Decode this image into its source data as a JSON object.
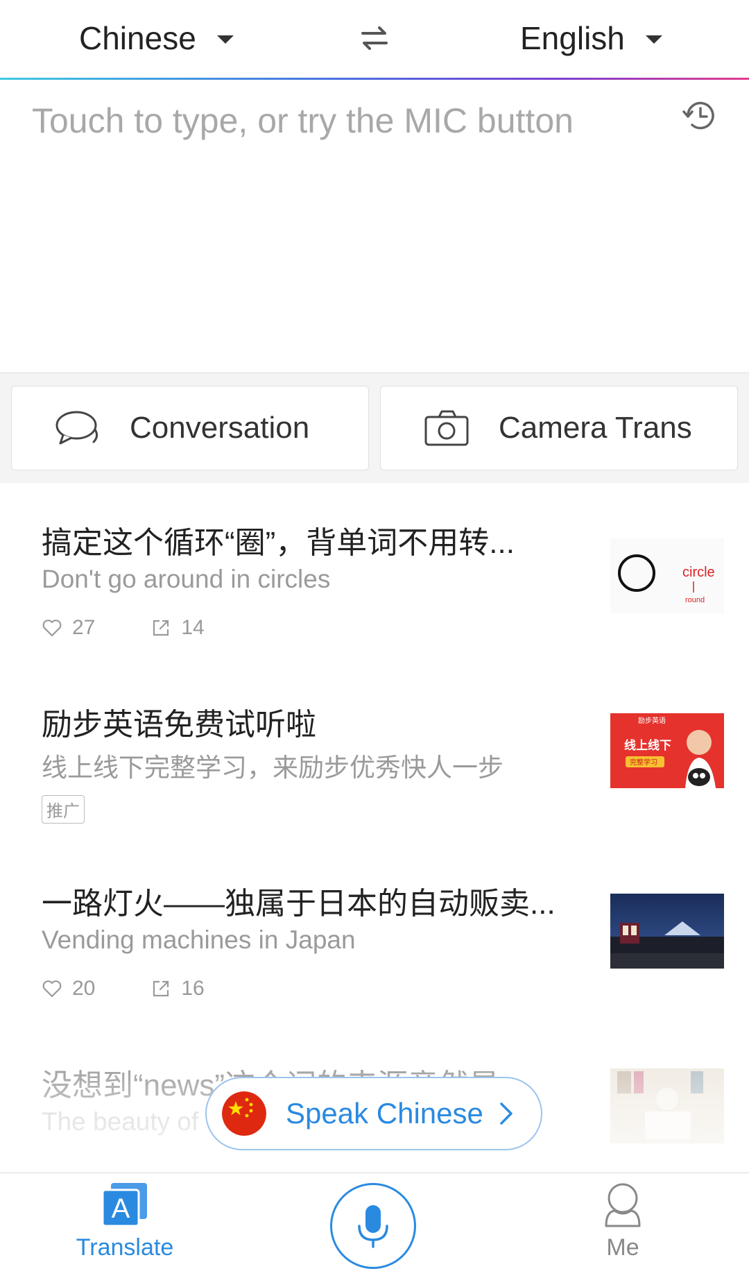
{
  "header": {
    "source_lang": "Chinese",
    "target_lang": "English"
  },
  "input": {
    "placeholder": "Touch to type, or try the MIC button"
  },
  "actions": {
    "conversation_label": "Conversation",
    "camera_label": "Camera Trans"
  },
  "feed": [
    {
      "title": "搞定这个循环“圈”，背单词不用转...",
      "subtitle": "Don't go around in circles",
      "likes": "27",
      "shares": "14",
      "thumb_text": "circle",
      "thumb_sub": "round"
    },
    {
      "title": "励步英语免费试听啦",
      "subtitle": "线上线下完整学习，来励步优秀快人一步",
      "tag": "推广",
      "thumb_text": "线上线下",
      "thumb_sub": "完整学习",
      "thumb_brand": "励步英语"
    },
    {
      "title": "一路灯火——独属于日本的自动贩卖...",
      "subtitle": "Vending machines in Japan",
      "likes": "20",
      "shares": "16"
    },
    {
      "title": "没想到“news”这个词的来源竟然是...",
      "subtitle": "The beauty of"
    }
  ],
  "speak_button": {
    "label": "Speak Chinese"
  },
  "bottom_nav": {
    "translate_label": "Translate",
    "me_label": "Me"
  },
  "colors": {
    "accent": "#2a8ae0",
    "gradient": [
      "#3ec8e0",
      "#7b3fd0",
      "#e23a8c"
    ]
  }
}
